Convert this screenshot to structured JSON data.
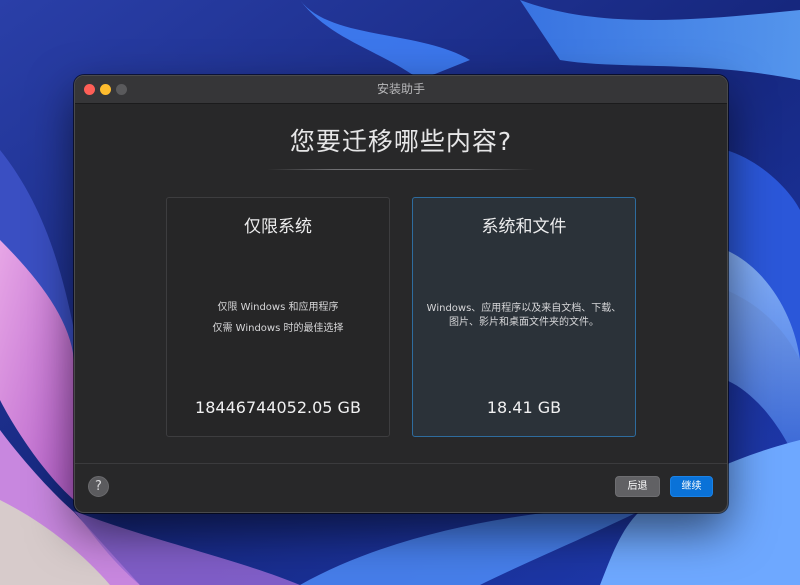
{
  "window": {
    "title": "安装助手"
  },
  "main": {
    "heading": "您要迁移哪些内容?"
  },
  "options": [
    {
      "title": "仅限系统",
      "description_lines": [
        "仅限 Windows 和应用程序",
        "仅需 Windows 时的最佳选择"
      ],
      "size": "18446744052.05 GB",
      "selected": false
    },
    {
      "title": "系统和文件",
      "description_lines": [
        "Windows、应用程序以及来自文档、下载、",
        "图片、影片和桌面文件夹的文件。"
      ],
      "size": "18.41 GB",
      "selected": true
    }
  ],
  "footer": {
    "help_label": "?",
    "back_label": "后退",
    "continue_label": "继续"
  },
  "colors": {
    "accent": "#0a72d8",
    "selected_border": "#2e6c9e",
    "window_bg": "#282829"
  },
  "icons": {
    "help": "question-mark-icon"
  }
}
